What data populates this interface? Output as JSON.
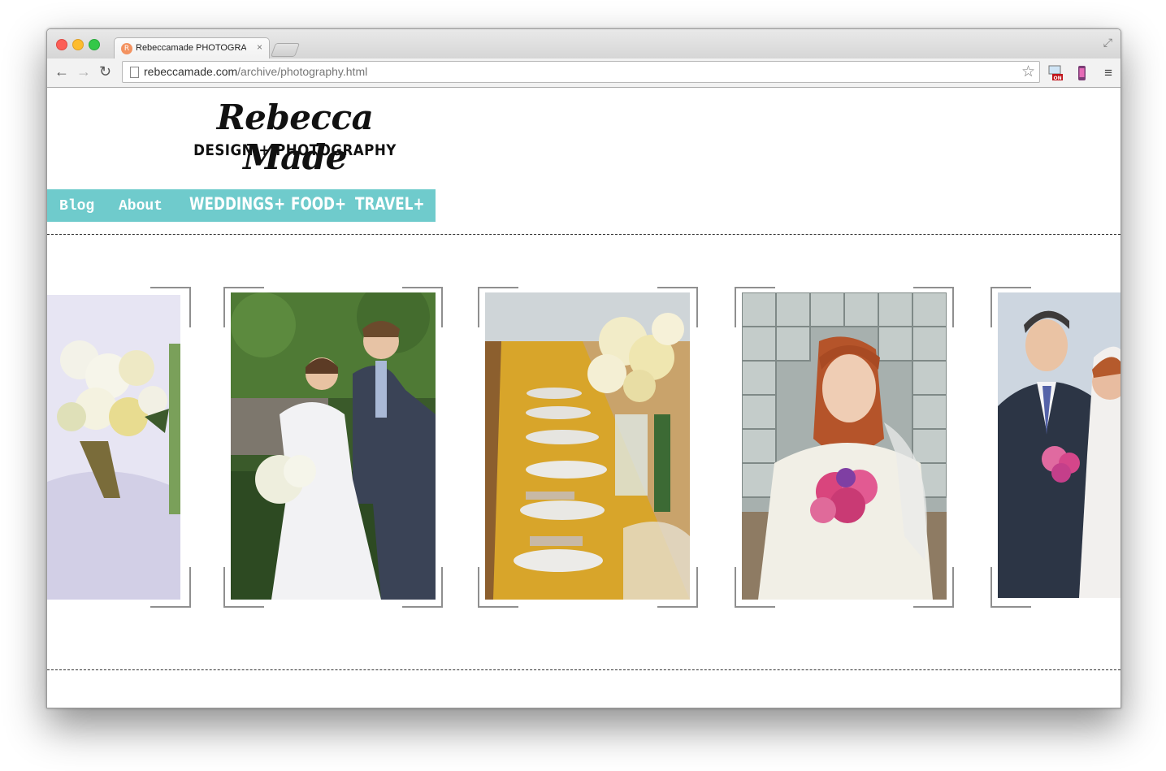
{
  "browser": {
    "tab_title": "Rebeccamade PHOTOGRAPHY",
    "tab_favicon_letter": "R",
    "tab_close": "×",
    "url_host": "rebeccamade.com",
    "url_path": "/archive/photography.html"
  },
  "site": {
    "logo_title": "Rebecca Made",
    "logo_subtitle": "DESIGN + PHOTOGRAPHY"
  },
  "nav": [
    {
      "label": "Blog"
    },
    {
      "label": "About"
    },
    {
      "label": "WEDDINGS+"
    },
    {
      "label": "FOOD+"
    },
    {
      "label": "TRAVEL+"
    }
  ],
  "gallery": {
    "photos": [
      {
        "subject": "bride-bouquet"
      },
      {
        "subject": "bride-and-groom"
      },
      {
        "subject": "table-setting"
      },
      {
        "subject": "bride-portrait"
      },
      {
        "subject": "groom-and-bride"
      }
    ]
  },
  "colors": {
    "nav_background": "#6fcbcc",
    "nav_text": "#ffffff",
    "frame": "#8f8f8f"
  }
}
